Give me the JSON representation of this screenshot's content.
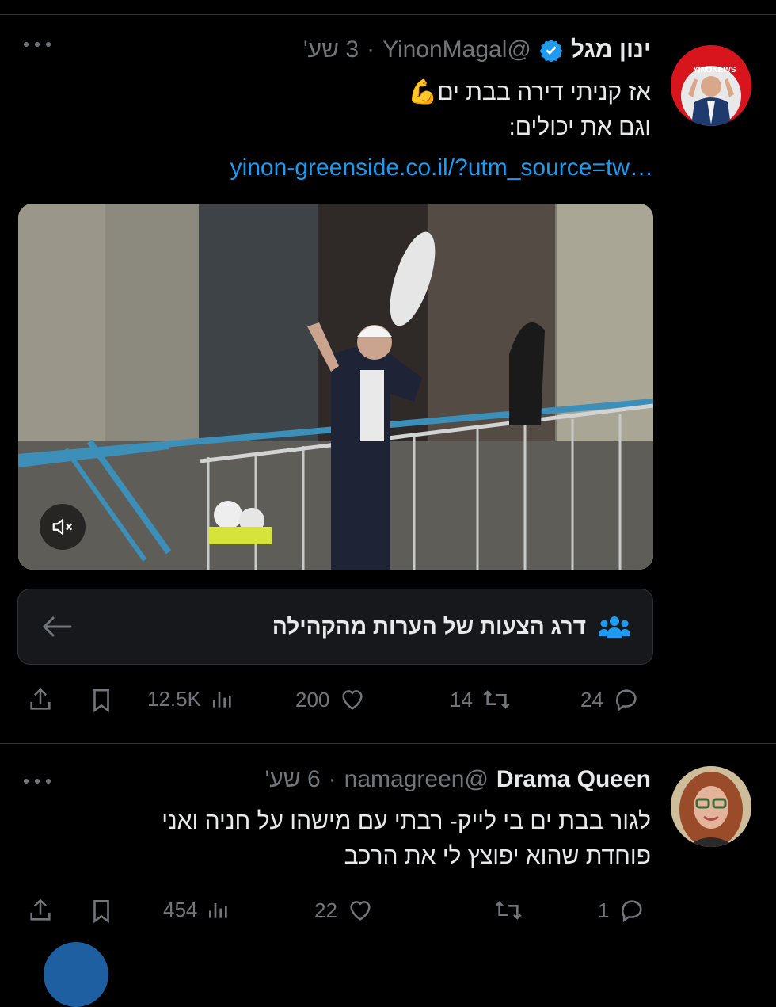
{
  "tweets": [
    {
      "name": "ינון מגל",
      "handle": "@YinonMagal",
      "time": "3 שע'",
      "verified": true,
      "avatar_badge": "YINONEWS",
      "text_lines": [
        "אז קניתי דירה בבת ים💪",
        "וגם את יכולים:"
      ],
      "link": "yinon-greenside.co.il/?utm_source=tw…",
      "community_notes": "דרג הצעות של הערות מהקהילה",
      "stats": {
        "views": "12.5K",
        "likes": "200",
        "retweets": "14",
        "replies": "24"
      }
    },
    {
      "name": "Drama Queen",
      "handle": "@namagreen",
      "time": "6 שע'",
      "text_lines": [
        "לגור בבת ים בי לייק- רבתי עם מישהו על חניה ואני",
        "פוחדת שהוא יפוצץ לי את הרכב"
      ],
      "stats": {
        "views": "454",
        "likes": "22",
        "retweets": "",
        "replies": "1"
      }
    }
  ],
  "colors": {
    "background": "#000000",
    "text": "#e7e9ea",
    "muted": "#71767b",
    "link": "#1d9bf0",
    "verified": "#1d9bf0"
  },
  "icons": [
    "more-icon",
    "verified-badge-icon",
    "mute-icon",
    "community-icon",
    "arrow-left-icon",
    "share-icon",
    "bookmark-icon",
    "views-icon",
    "like-icon",
    "retweet-icon",
    "reply-icon"
  ]
}
